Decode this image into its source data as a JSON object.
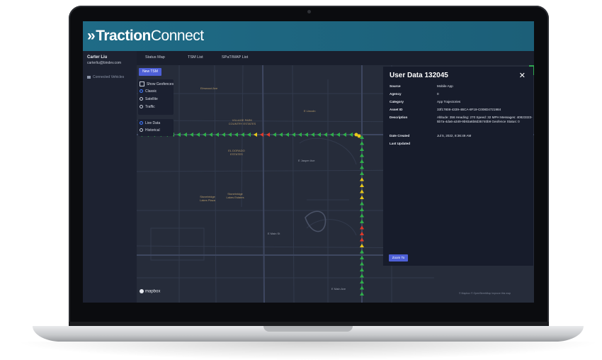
{
  "app": {
    "logo_chevrons": "»",
    "logo_bold": "Traction",
    "logo_light": "Connect"
  },
  "sidebar": {
    "user_name": "Carter Liu",
    "user_email": "carterliu@bindev.com",
    "items": [
      {
        "label": "Connected Vehicles",
        "icon": "car-icon"
      }
    ]
  },
  "tabs": [
    {
      "label": "Status Map"
    },
    {
      "label": "TSM List"
    },
    {
      "label": "SPaT/MAP List"
    }
  ],
  "map_controls": {
    "new_ttm_label": "New TSM",
    "show_geofences_label": "Show Geofences",
    "styles": [
      "Classic",
      "Satellite",
      "Traffic"
    ],
    "selected_style": "Classic",
    "modes": [
      "Live Data",
      "Historical"
    ],
    "selected_mode": "Live Data"
  },
  "map": {
    "labels": [
      "Elmwood Ave",
      "VILLAGE PARK COUNTRY ESTATES",
      "E Lincoln",
      "EL DORADO ESTATES",
      "E Jasper Ave",
      "Stonebridge Lakes Plaza",
      "Stonebridge Lakes Estates",
      "E Main St",
      "E Main Ave"
    ],
    "attribution": "© Mapbox © OpenStreetMap Improve this map",
    "mapbox_label": "mapbox",
    "colors": {
      "green": "#2fb04a",
      "yellow": "#e8c81a",
      "red": "#e23a2a",
      "background": "#262c3a"
    }
  },
  "detail": {
    "title": "User Data 132045",
    "close_icon": "close-icon",
    "rows": [
      {
        "key": "Source",
        "value": "Mobile App"
      },
      {
        "key": "Agency",
        "value": "0"
      },
      {
        "key": "Category",
        "value": "App Trajectories"
      },
      {
        "key": "Asset ID",
        "value": "33f17808-4339-4BCA-8F19-C008D4721984"
      },
      {
        "key": "Description",
        "value": "Altitude: 356 Heading: 270 Speed: 32 MPH Messages: 40823323-5b7a-4da6-a349-9b93a6b8d35740b9 Geofence Status: 0"
      },
      {
        "key": "Date Created",
        "value": "Jul 5, 2022, 8:36:49 AM"
      },
      {
        "key": "Last Updated",
        "value": ""
      }
    ],
    "zoom_label": "Zoom To"
  }
}
